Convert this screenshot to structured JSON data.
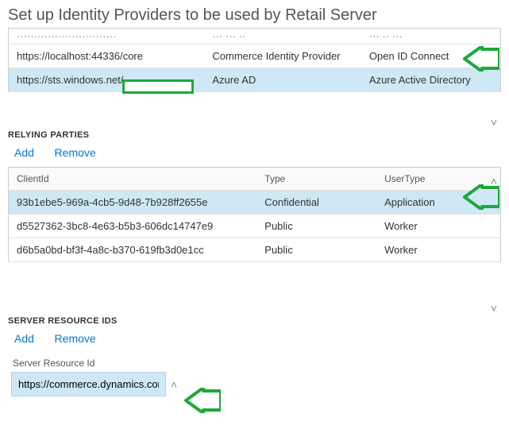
{
  "page": {
    "title": "Set up Identity Providers to be used by Retail Server"
  },
  "identityProviders": {
    "rows": [
      {
        "issuer": "https://localhost:44336/core",
        "name": "Commerce Identity Provider",
        "type": "Open ID Connect"
      },
      {
        "issuer": "https://sts.windows.net/",
        "name": "Azure AD",
        "type": "Azure Active Directory"
      }
    ]
  },
  "relyingParties": {
    "header": "RELYING PARTIES",
    "addLabel": "Add",
    "removeLabel": "Remove",
    "columns": {
      "clientId": "ClientId",
      "type": "Type",
      "userType": "UserType"
    },
    "rows": [
      {
        "clientId": "93b1ebe5-969a-4cb5-9d48-7b928ff2655e",
        "type": "Confidential",
        "userType": "Application"
      },
      {
        "clientId": "d5527362-3bc8-4e63-b5b3-606dc14747e9",
        "type": "Public",
        "userType": "Worker"
      },
      {
        "clientId": "d6b5a0bd-bf3f-4a8c-b370-619fb3d0e1cc",
        "type": "Public",
        "userType": "Worker"
      }
    ]
  },
  "serverResourceIds": {
    "header": "SERVER RESOURCE IDS",
    "addLabel": "Add",
    "removeLabel": "Remove",
    "label": "Server Resource Id",
    "value": "https://commerce.dynamics.com"
  },
  "colors": {
    "link": "#0078d4",
    "selection": "#cfe8f6",
    "annotation": "#1aaa3a"
  }
}
